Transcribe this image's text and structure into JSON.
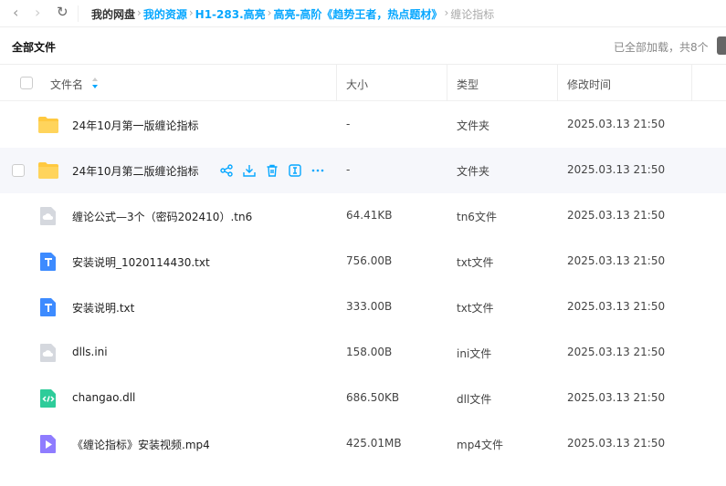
{
  "nav": {
    "back": "‹",
    "forward": "›",
    "refresh": "↻"
  },
  "breadcrumb": [
    "我的网盘",
    "我的资源",
    "H1-283.高亮",
    "高亮-高阶《趋势王者，热点题材》",
    "缠论指标"
  ],
  "toolbar": {
    "title": "全部文件",
    "status": "已全部加载，共8个"
  },
  "columns": {
    "name": "文件名",
    "size": "大小",
    "type": "类型",
    "modified": "修改时间"
  },
  "colors": {
    "accent": "#06a7ff",
    "folder": "#ffc940"
  },
  "files": [
    {
      "name": "24年10月第一版缠论指标",
      "size": "-",
      "type": "文件夹",
      "modified": "2025.03.13 21:50",
      "icon": "folder-icon"
    },
    {
      "name": "24年10月第二版缠论指标",
      "size": "-",
      "type": "文件夹",
      "modified": "2025.03.13 21:50",
      "icon": "folder-icon",
      "hover": true
    },
    {
      "name": "缠论公式—3个（密码202410）.tn6",
      "size": "64.41KB",
      "type": "tn6文件",
      "modified": "2025.03.13 21:50",
      "icon": "unknown-file-icon"
    },
    {
      "name": "安装说明_1020114430.txt",
      "size": "756.00B",
      "type": "txt文件",
      "modified": "2025.03.13 21:50",
      "icon": "text-file-icon"
    },
    {
      "name": "安装说明.txt",
      "size": "333.00B",
      "type": "txt文件",
      "modified": "2025.03.13 21:50",
      "icon": "text-file-icon"
    },
    {
      "name": "dlls.ini",
      "size": "158.00B",
      "type": "ini文件",
      "modified": "2025.03.13 21:50",
      "icon": "unknown-file-icon"
    },
    {
      "name": "changao.dll",
      "size": "686.50KB",
      "type": "dll文件",
      "modified": "2025.03.13 21:50",
      "icon": "code-file-icon"
    },
    {
      "name": "《缠论指标》安装视频.mp4",
      "size": "425.01MB",
      "type": "mp4文件",
      "modified": "2025.03.13 21:50",
      "icon": "video-file-icon"
    }
  ]
}
